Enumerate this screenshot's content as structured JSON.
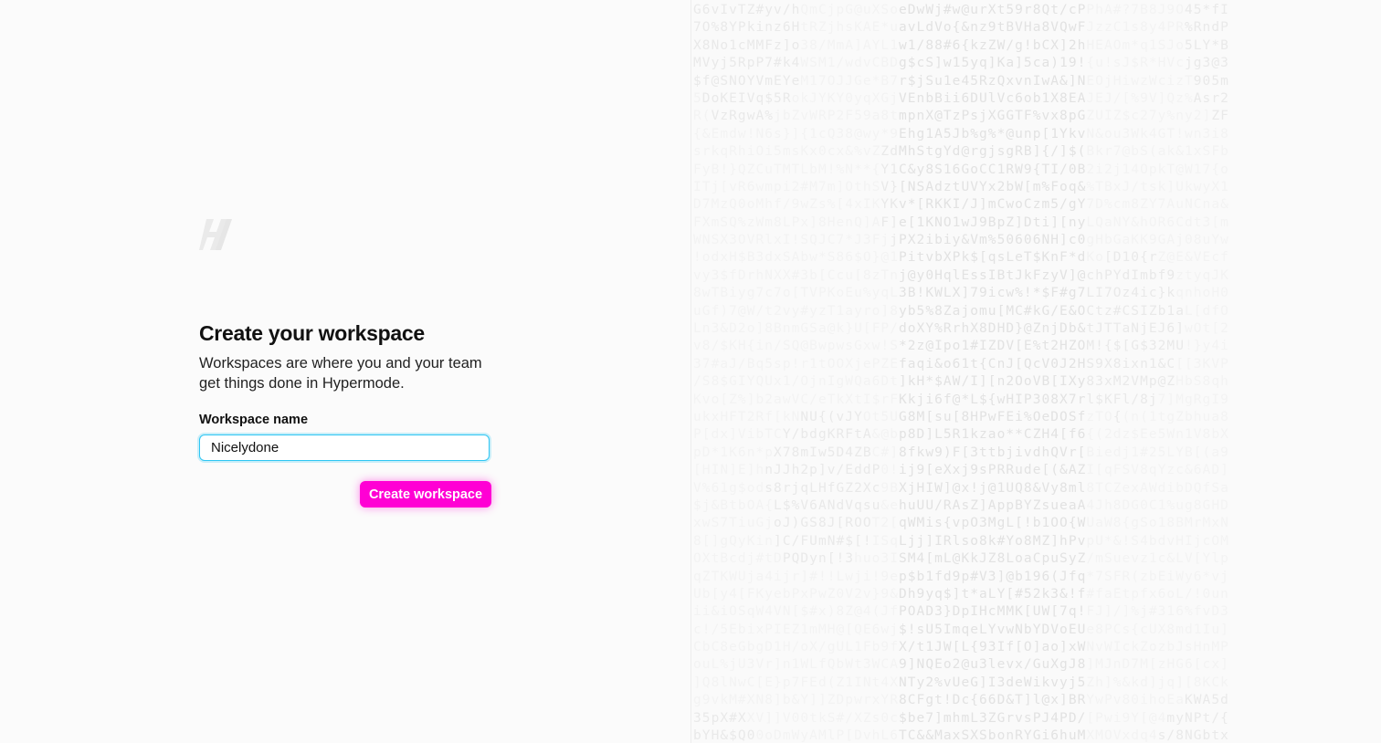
{
  "form": {
    "title": "Create your workspace",
    "subtitle": "Workspaces are where you and your team get things done in Hypermode.",
    "field_label": "Workspace name",
    "field_value": "Nicelydone",
    "submit_label": "Create workspace"
  },
  "colors": {
    "accent": "#ff00d4",
    "focus_ring": "#2ec6f3"
  },
  "icons": {
    "logo": "hypermode-logo-icon"
  },
  "background_text_seed": "G6vIvTZ#yv/hQmCjpG@uXSoeDwWj#w@urXt59r8Qt/cPPhA#?7B8J9O45*fI7O%8YPkinz6HtRZjhsKAE*uavLdVo{&nz9tBVHa8VQwFJzzC1s8y4PR%RndPX8No1cMMFz]o38/MmA]AYL1w1/88#6{kzZW/g!bCX]2hHEAOm*q1SJo5LY*BMVyj5RpP7#k4WSM1/wdvCBDg$cS]w15yq]Ka]5ca)19!{u!sJ$R*HVcjg3@3$f@SNOYVmEYeM17OJJGe*B7r$jSu1e45RzQxvnIwA&]NEOjHiwzWcizT905m5DoKEIVq$5RokJYKY0yqXGjVEnbBii6DUlVc6ob1X8EAJEJ/[%9V]Qz%Asr2R(VzRgwA%jbZvWRP2F59a8tmpnX@TzPsjXGGTF%vx8pGZUIZ$c27y%ny2]ZF{&Emdw!N6s}]{1cQ38@wy*9Ehg1A5Jb%g%*@unp[1YkvN&ou3Wk4GT!wn3i8srkqRhiOi5msKx0cx&%vZZdMhStgYd@rgjsgRB]{/]$(Bkr7@bS(ak&1xSFbFyB!}QZCuTMTLbM!%N**{Y1C&y8S16GoCC1RW9{TI/0B2i2j14OpkT@W17{oITj[vR6wmpi2#M7m]OthSV}[NSAdztUVYx2bW[m%Foq&%TBxJ/tsk]UkwyX1D7MzQ0oMhf/9wZs%[4xIKYKv*[RKKI/J]mCwoCzm5/gY7D%cm8ZY7AuNCna&FXmSQ%zWm8LPx]8HenQ]AF]e[1KNO1wJ9BpZ]Dti][nyLQaNY&hOR6Cdt3[mWNSX3OVRlxI!SQJC7*J3FjjPX2ibiy&Vm%50606NH]c0gHbGaKK9GAj08uYw!odxH$B3dxSAbw*S86$O}@1PitvbXPk$[qsLeT$KnF*dKo[D10{rZ@E&VEcfvy3$fDrhNXX#3b[Ccu[8zTnj@y0HqlEssIBtJkFzyV]@chPYdImbf9ztyqJK8wTBiyg7c7o[TVPKoEu%yqL3B!KWLX]79icw%!*$F#g7LI7Oz4ic}kqnhoH0uGf)7@W/t2vy#yzT1ayro]8yb5%8Zajomu[MC#kG/E&OCtz#CSIZb1aL[dfOLn3&D2o]8BnmGSa@k}U[FP/doXY%RrhX8DHD}@ZnjDb&tJTTaNjEJ6]wOt[2v8/$KH{in/SQ@BwpwsGxw!S*2z@Ipo1#IZDV[E%t2HZOM!{$[G$32MU!}y4i37#aJ/Bq5sp!r1tOOXjePZEfaqi&o61t{CnJ[QcV0J2HS9X8ixn1&C[[3KVP/S8$GIYQUx1/OjnIgWQa6Dt]kH*$AW/I][n2OoVB[IXy83xM2VMp@ZHbS8qhKvo[Z%]b2awVC/eTkXtI$rFKkji6f@*L${wHIP308X7rl$KFl/8j7]MgRgI9ukxHFT2Rf[kNNU{(vJYOt5UG8M[su[8HPwFEi%OeDOSfzTO{(n(1tgZbhua8P[dx]VibTCY/bdgKRFtA&@bp8D]L5R1kzao**CZH4[f6{(2dz$Ee5Wn1V8bXpD*1K6n*pX78mIw5D4ZBC#]8fkw9)F[3ttbjivdhQVr[Biedj1#25LYB[(a9[HIN]E]hnJJh2p]v/EddP0!ij9[eXxj9sPRRude[(&AZI[qFSV8qYzc&6AD]V%61g$ods8rjqLHfGZ2Xc9BXjHIW]@x!j@1UQ8&Vy8ml8TCZexAWdibDQfSa$j&BtbOA{L$%V6ANdVqsu&ehuUU/RAsZ]AppBYZsueaA4Jh8DG0C1%ug8GHDxwS7TiuGjoJ)GS8J[ROOT2[qWMis{vpO3MgL[!b1OO{WUaW8{gSo18BMrMxN8[]gQyKin]C/FUmN#$[!ISqLjj]IRlso8k#Yo8MZ]hPvpU*&!S4bdvHIjcOMOXtBcdj#tDPQDyn[!3huo3ISM4[mL@KkJZ8LoaCpuSyZ/mSuevz1c&LV[YlpqZTKWUja4ijr]#!!Lwji!9ep$b1fd9p#V3]@b196(Jfq*7SFR(zbEiWy6*vjUb[y4[FKyebPxPwZ0V2v}9&Dh9yq$]t*aLY[#52k3&!f#faEtpfx6oL/!0unii&iOSqW4VN[$#x)8Z@4(JfPOAD3}DpIHcMMK[UW[7q!FJ]/]%j#316%fvD3c!/5EbixPIEZ1mMH@[QE6wj$!sU5ImqeLYvwNbYDVoEUe8PCs{cUX8md1Iu]CbC8eGbgD1H/oX/gUL1Fb9fX/t1JW[L{93If[O]ao]xWNvWIckZozbJsHnMPouL%jU3Vr]n1WLfQbWt3WCA9]NQEo2@u3levx/GuXgJ8]MJnD7M[zHG6[cx]]Q8lNwC[E}p7FEd(Z1INt4XNTy2%vUeG]I3deWikvyj5Zh]%&kd]jq][8KCkg9vkM#XN8]b&Y]]ZDpwrxYR8CFgt!Dc{66D&T]l@x]BRYwPv80ihoEaKWA5d35pX#XXV]]V00tkS#/XZs0c$be7]mhmL3ZGrvsPJ4PD/[Pwi9Y[@4myNPt/{bYH&$Q00oDmWyAMlP[DvhL6TC&&MaxSXSbonRYGi6huMXMOVxdq4s/8NGbtxJTFCq0d3DaPLyHG*gYHlbqnCJ@]%yQ#NYa9GAT91n&3OIZg6#*IyuvSM@vIOPAS4S#bXHE4VAj!wDGFysjd8yJ7J[k[a5w8@Ys9f{U/jKE]S@5J3914?I2[GE]7ArR[]*AZIBsx*I(x5w6xaB7Q0(MdYVBAnNtrkrqfo9a#3[%72@ijjJ/KXIgyVE6[teJ5VwBN8m8b5kP9EebB6]Ccd*ooKnMN6lP8BpfAwLO{a#r&ms(xg!#YVTUDvc%8UJM%6amRUAwImax&}*aDQR55vaavy*@ruwwR%*4mg2Qyr}E/@[1xPmc7c[r8dX51CI8$kleFnsgJ%6CF0F{$qVsfjFMqL5vVgJI5[[Hr$loVBm0drVfjprlh)*carFpCTXhvTmGPLfti]ydXQL77g}B@GdkhPmk5O8}y9nA0swa4aQSy$!w%6Pvfc*]k7MhHN3]4HWWmeJhRSeTpUraKaBy%UOLOnj#wb%vxzDf1J8lPmTiRHjvSv05V$2#kOCu[mxMw*00q2XFM]*v&kjY#xqnM#icgx6/oXUlOt&MmFoN7#73qf2n]{CG#&SY16OJ3zq]4m/]#4YWwjmUNZq9k[CXAvXZwMPngVYw0vT$V]csoGZ1NmSa${1ApK1E07]mSJJ3I815HN[ZS4eM9rXtd0ZA1JfCo$yZ1Ndigz3j6NM]X4ouqd[e#]dAacq&ku8h[LQoSgw[RUyFKCI1d/zDl8pYSKW$#I#N%7l0suN56*Z3[OdSKfmIxyI766vxPwHAI3j$3UUgCKo$LB58r8U5Ia2phzBb#PprJ9tTNrr#aVN#UTvcGIRcmIheeneMcIDPayZCK#K8bwNCIahDQvlV%F2A1*ma$Kt#fmpTvQnpm*5kmumqvlRQx/WwB"
}
